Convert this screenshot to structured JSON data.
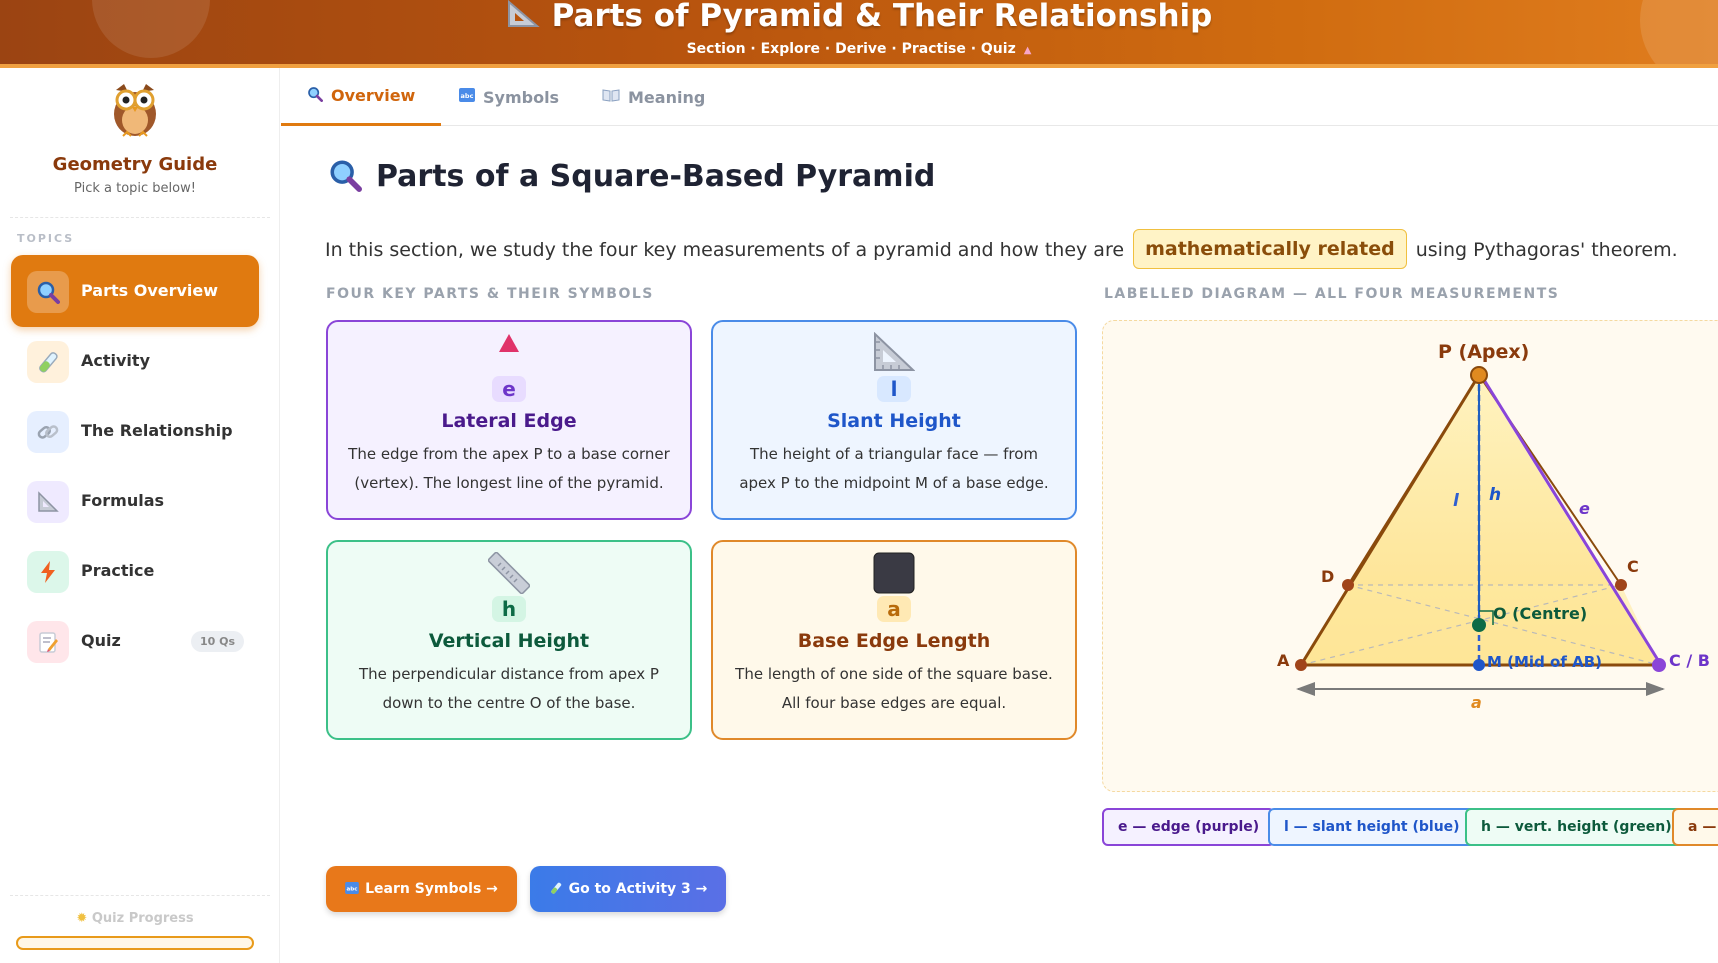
{
  "header": {
    "icon": "triangle-ruler-icon",
    "title": "Parts of Pyramid & Their Relationship",
    "subtitle": "Section · Explore · Derive · Practise · Quiz"
  },
  "sidebar": {
    "brand": "Geometry Guide",
    "brand_sub": "Pick a topic below!",
    "topics_label": "TOPICS",
    "items": [
      {
        "label": "Parts Overview",
        "icon": "magnifier-icon",
        "active": true
      },
      {
        "label": "Activity",
        "icon": "test-tube-icon"
      },
      {
        "label": "The Relationship",
        "icon": "link-icon"
      },
      {
        "label": "Formulas",
        "icon": "triangle-ruler-icon"
      },
      {
        "label": "Practice",
        "icon": "lightning-icon"
      },
      {
        "label": "Quiz",
        "icon": "memo-icon",
        "badge": "10 Qs"
      }
    ],
    "quiz_progress_label": "Quiz Progress",
    "quiz_progress_fraction": 0
  },
  "tabs": [
    {
      "label": "Overview",
      "icon": "magnifier-icon",
      "active": true
    },
    {
      "label": "Symbols",
      "icon": "abc-icon"
    },
    {
      "label": "Meaning",
      "icon": "book-icon"
    }
  ],
  "main": {
    "title": "Parts of a Square-Based Pyramid",
    "intro_before": "In this section, we study the four key measurements of a pyramid and how they are",
    "intro_highlight": "mathematically related",
    "intro_after": "using Pythagoras' theorem.",
    "parts_label": "FOUR KEY PARTS & THEIR SYMBOLS",
    "diagram_label": "LABELLED DIAGRAM — ALL FOUR MEASUREMENTS",
    "cards": [
      {
        "symbol": "e",
        "title": "Lateral Edge",
        "desc": "The edge from the apex P to a base corner (vertex). The longest line of the pyramid.",
        "icon": "red-triangle-icon"
      },
      {
        "symbol": "l",
        "title": "Slant Height",
        "desc": "The height of a triangular face — from apex P to the midpoint M of a base edge.",
        "icon": "triangle-ruler-icon"
      },
      {
        "symbol": "h",
        "title": "Vertical Height",
        "desc": "The perpendicular distance from apex P down to the centre O of the base.",
        "icon": "ruler-icon"
      },
      {
        "symbol": "a",
        "title": "Base Edge Length",
        "desc": "The length of one side of the square base. All four base edges are equal.",
        "icon": "black-square-icon"
      }
    ],
    "diagram": {
      "apex": "P (Apex)",
      "a": "A",
      "c": "C",
      "d": "D",
      "c_or_b": "C / B",
      "centre": "O (Centre)",
      "mid": "M (Mid of AB)",
      "l": "l",
      "h": "h",
      "e": "e",
      "base": "a"
    },
    "legend": [
      {
        "text": "e — edge (purple)",
        "color": "#8a45d8"
      },
      {
        "text": "l — slant height (blue)",
        "color": "#4a8be8"
      },
      {
        "text": "h — vert. height (green)",
        "color": "#3cc088"
      },
      {
        "text": "a — base edge (amber)",
        "color": "#e0892a"
      }
    ],
    "buttons": {
      "learn": "Learn Symbols →",
      "activity": "Go to Activity 3 →"
    }
  }
}
